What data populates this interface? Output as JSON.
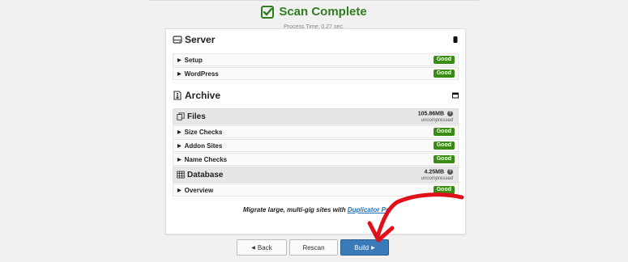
{
  "header": {
    "title": "Scan Complete",
    "subtitle": "Process Time: 0.27 sec."
  },
  "server": {
    "title": "Server",
    "rows": [
      {
        "label": "Setup",
        "status": "Good"
      },
      {
        "label": "WordPress",
        "status": "Good"
      }
    ]
  },
  "archive": {
    "title": "Archive",
    "files": {
      "label": "Files",
      "size": "105.86MB",
      "size_note": "uncompressed",
      "rows": [
        {
          "label": "Size Checks",
          "status": "Good"
        },
        {
          "label": "Addon Sites",
          "status": "Good"
        },
        {
          "label": "Name Checks",
          "status": "Good"
        }
      ]
    },
    "database": {
      "label": "Database",
      "size": "4.25MB",
      "size_note": "uncompressed",
      "rows": [
        {
          "label": "Overview",
          "status": "Good"
        }
      ]
    }
  },
  "promo": {
    "text": "Migrate large, multi-gig sites with",
    "link_text": "Duplicator Pr"
  },
  "buttons": {
    "back": "Back",
    "rescan": "Rescan",
    "build": "Build"
  },
  "icons": {
    "help": "?",
    "back_arrow": "◀",
    "build_arrow": "▶",
    "caret": "▶"
  },
  "colors": {
    "good_badge": "#3a8b12",
    "header_green": "#2f7d1f",
    "build_button": "#3a7ab8",
    "annotation_arrow": "#e0101a",
    "link": "#1f6fbf"
  }
}
